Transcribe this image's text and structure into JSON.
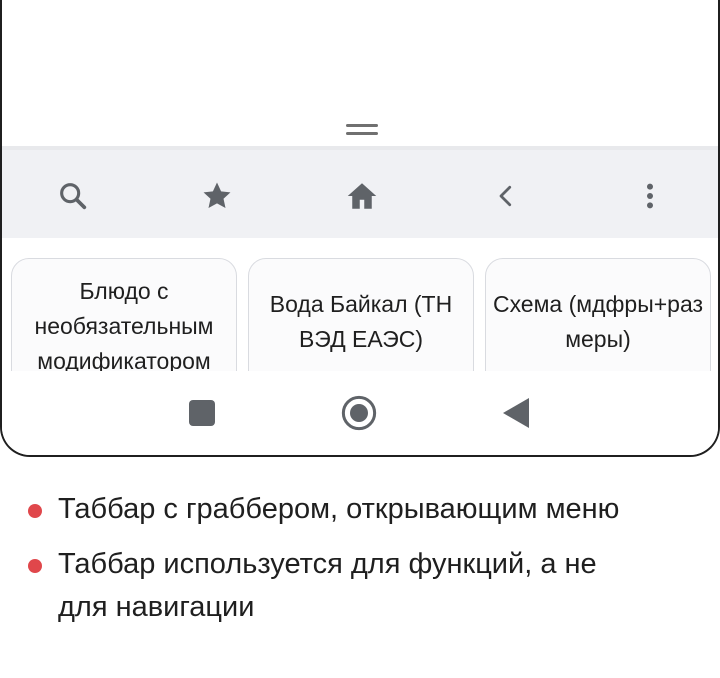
{
  "tabbar": {
    "icons": [
      "search-icon",
      "star-icon",
      "home-icon",
      "chevron-left-icon",
      "more-vertical-icon"
    ]
  },
  "cards": [
    {
      "label": "Блюдо с необязательным модификатором"
    },
    {
      "label": "Вода Байкал (ТН ВЭД ЕАЭС)"
    },
    {
      "label": "Схема (мдфры+размеры)"
    }
  ],
  "system_nav": {
    "icons": [
      "recents-square-icon",
      "home-circle-icon",
      "back-triangle-icon"
    ]
  },
  "notes": [
    {
      "text": "Таббар с граббером, открывающим меню"
    },
    {
      "text": "Таббар используется для функций, а не для навигации"
    }
  ],
  "colors": {
    "bullet": "#e0474b",
    "tabbar_bg": "#f0f1f4",
    "icon": "#5f6368",
    "card_border": "#d9dbe0"
  }
}
